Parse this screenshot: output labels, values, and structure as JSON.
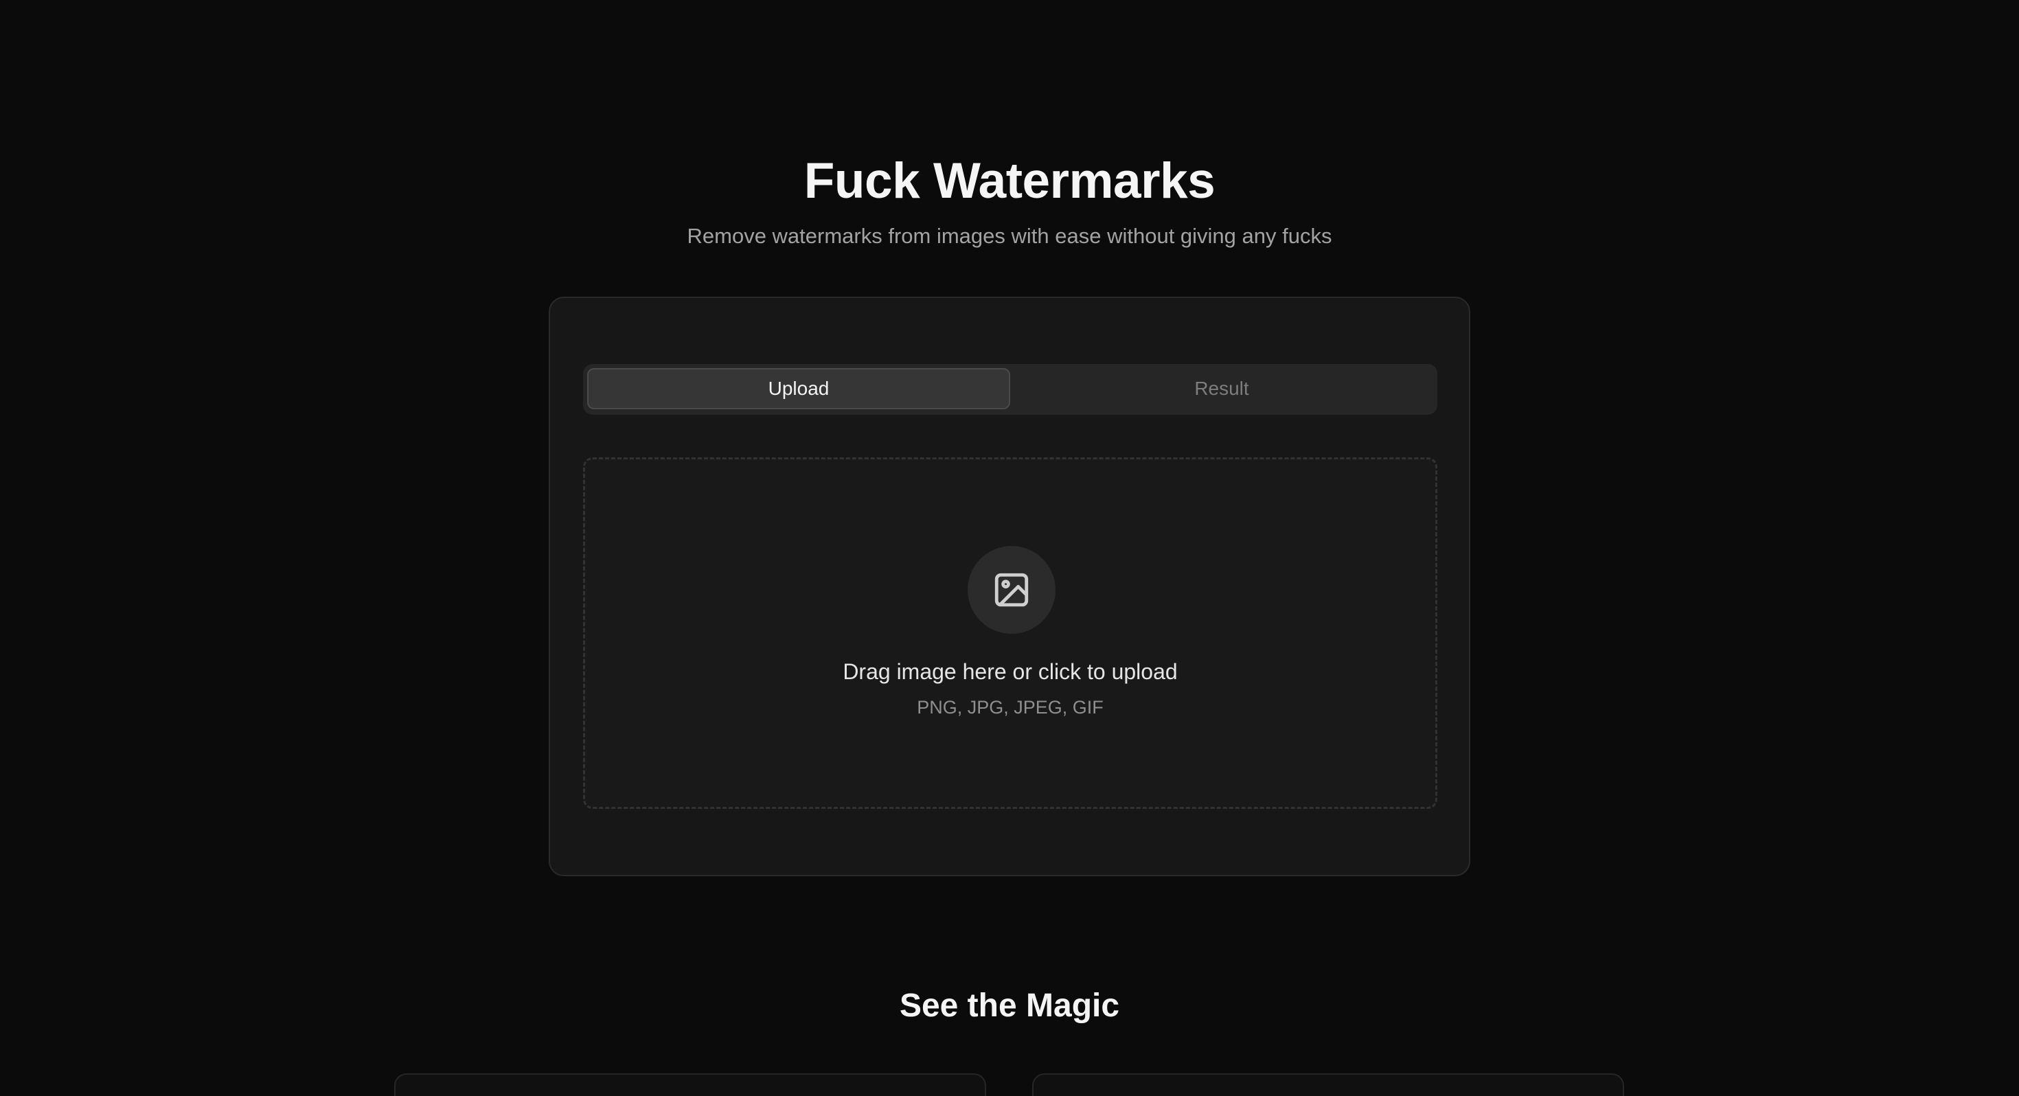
{
  "header": {
    "title": "Fuck Watermarks",
    "subtitle": "Remove watermarks from images with ease without giving any fucks"
  },
  "tabs": [
    {
      "label": "Upload",
      "active": true
    },
    {
      "label": "Result",
      "active": false
    }
  ],
  "dropzone": {
    "icon": "image-icon",
    "title": "Drag image here or click to upload",
    "formats": "PNG, JPG, JPEG, GIF"
  },
  "showcase": {
    "title": "See the Magic"
  },
  "colors": {
    "background": "#0b0b0b",
    "card": "#171717",
    "tab_active": "#363636",
    "muted_text": "#a3a3a3"
  }
}
